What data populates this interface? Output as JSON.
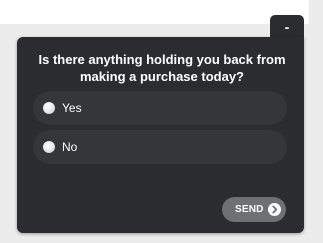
{
  "widget": {
    "minimize_label": "-",
    "question": "Is there anything holding you back from making a purchase today?",
    "options": [
      {
        "label": "Yes",
        "selected": false
      },
      {
        "label": "No",
        "selected": false
      }
    ],
    "send_label": "SEND",
    "send_icon": "chevron-right-circle-icon"
  },
  "colors": {
    "card_background": "#2b2c2e",
    "option_background": "#353638",
    "send_button_background": "#6f7072",
    "page_background": "#ececec"
  }
}
